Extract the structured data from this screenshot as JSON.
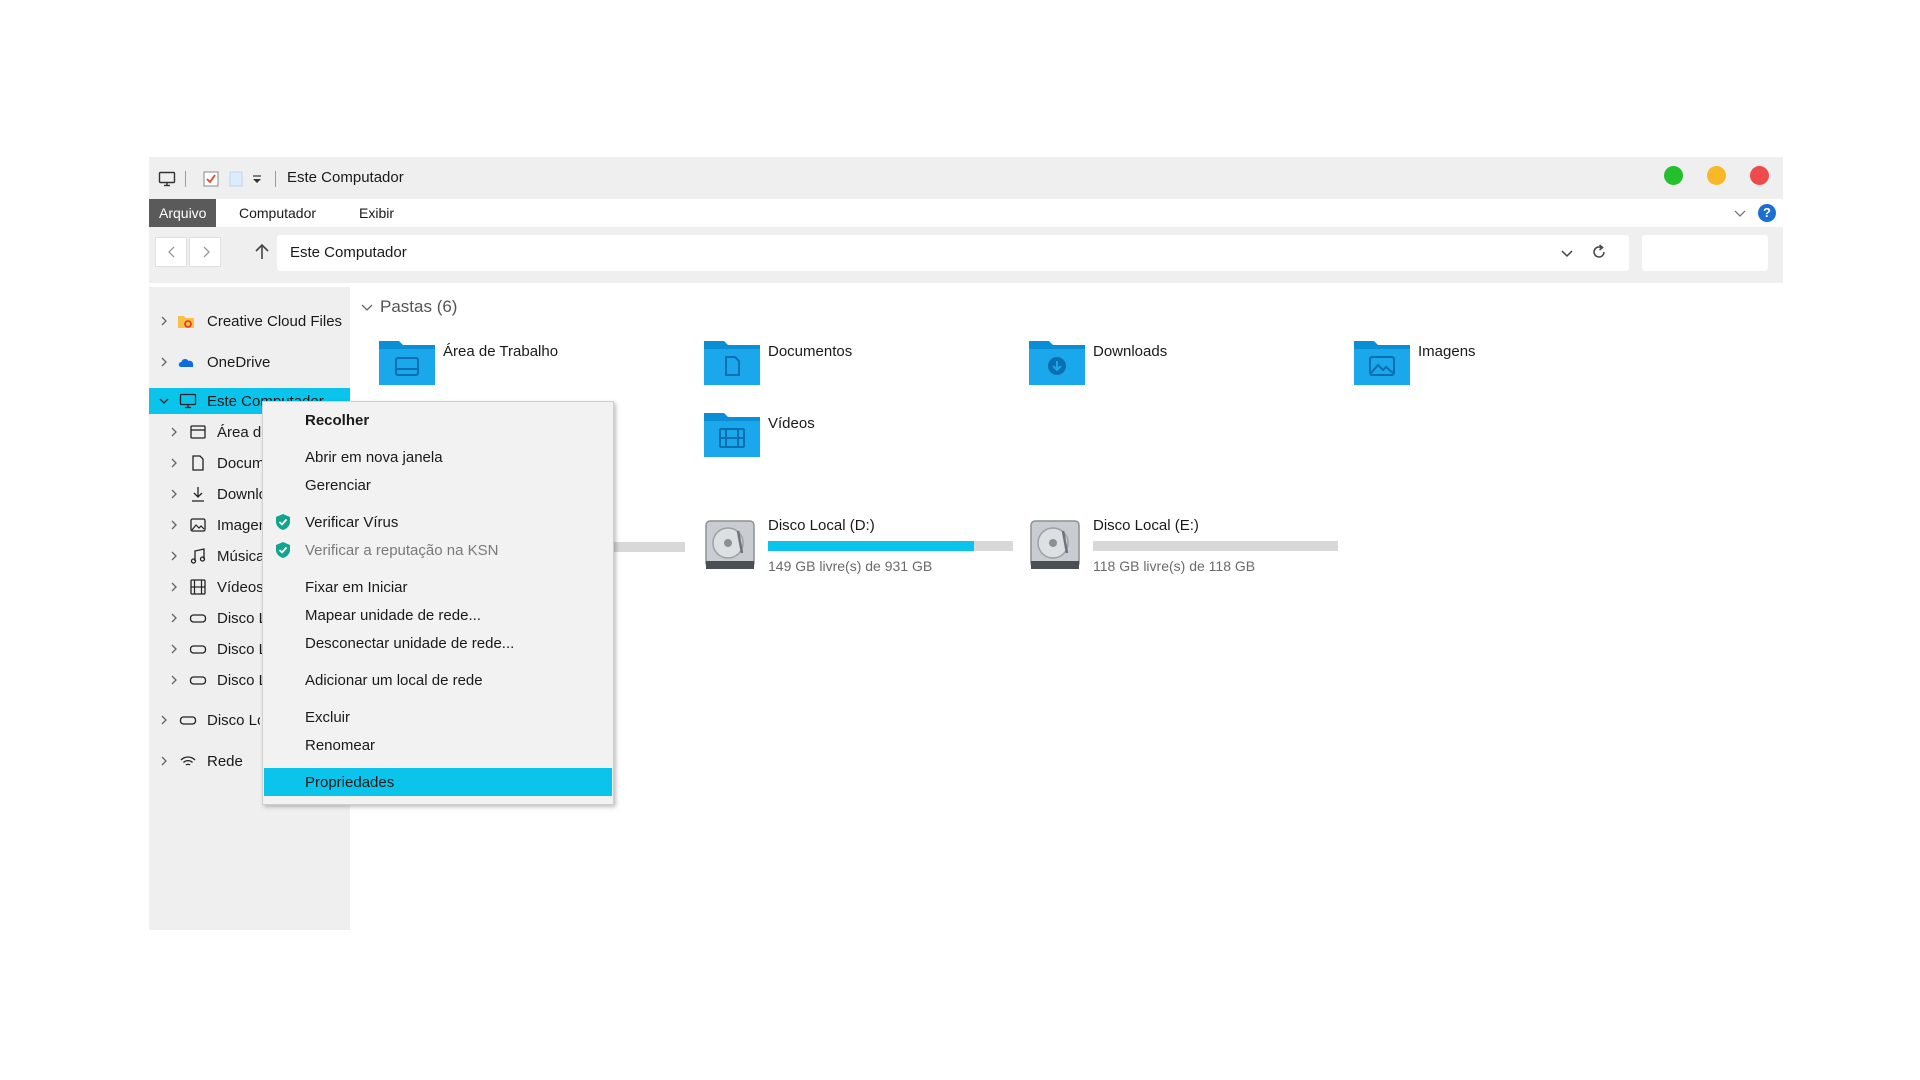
{
  "titlebar": {
    "title": "Este Computador",
    "colors": {
      "green": "#22c02a",
      "yellow": "#f9b825",
      "red": "#ef4b4b"
    }
  },
  "menubar": {
    "items": [
      "Arquivo",
      "Computador",
      "Exibir"
    ],
    "help_label": "?"
  },
  "address": {
    "path": "Este Computador"
  },
  "sidebar": {
    "items": [
      {
        "label": "Creative Cloud Files",
        "icon": "creative-cloud-folder-icon"
      },
      {
        "label": "OneDrive",
        "icon": "onedrive-cloud-icon"
      },
      {
        "label": "Este Computador",
        "icon": "computer-icon"
      },
      {
        "label": "Área de Trabalho",
        "icon": "desktop-icon"
      },
      {
        "label": "Documentos",
        "icon": "document-icon"
      },
      {
        "label": "Downloads",
        "icon": "download-icon"
      },
      {
        "label": "Imagens",
        "icon": "image-icon"
      },
      {
        "label": "Músicas",
        "icon": "music-icon"
      },
      {
        "label": "Vídeos",
        "icon": "video-icon"
      },
      {
        "label": "Disco Local (C:)",
        "icon": "drive-icon"
      },
      {
        "label": "Disco Local (D:)",
        "icon": "drive-icon"
      },
      {
        "label": "Disco Local (E:)",
        "icon": "drive-icon"
      },
      {
        "label": "Disco Local",
        "icon": "drive-icon"
      },
      {
        "label": "Rede",
        "icon": "network-icon"
      }
    ]
  },
  "content": {
    "group_title": "Pastas (6)",
    "folders": [
      {
        "label": "Área de Trabalho",
        "icon": "desktop-folder-icon"
      },
      {
        "label": "Documentos",
        "icon": "documents-folder-icon"
      },
      {
        "label": "Downloads",
        "icon": "downloads-folder-icon"
      },
      {
        "label": "Imagens",
        "icon": "images-folder-icon"
      },
      {
        "label": "Vídeos",
        "icon": "videos-folder-icon"
      }
    ],
    "drives": [
      {
        "name": "Disco Local (D:)",
        "free": "149 GB livre(s) de 931 GB",
        "used_fraction": 0.84
      },
      {
        "name": "Disco Local (E:)",
        "free": "118 GB livre(s) de 118 GB",
        "used_fraction": 0.0
      }
    ],
    "hidden_drive_used_fraction": 0.0
  },
  "context_menu": {
    "items": [
      {
        "label": "Recolher",
        "bold": true
      },
      {
        "label": "Abrir em nova janela"
      },
      {
        "label": "Gerenciar"
      },
      {
        "label": "Verificar Vírus",
        "icon": "shield-check-icon"
      },
      {
        "label": "Verificar a reputação na KSN",
        "icon": "shield-check-icon",
        "disabled": true
      },
      {
        "label": "Fixar em Iniciar"
      },
      {
        "label": "Mapear unidade de rede..."
      },
      {
        "label": "Desconectar unidade de rede..."
      },
      {
        "label": "Adicionar um local de rede"
      },
      {
        "label": "Excluir"
      },
      {
        "label": "Renomear"
      },
      {
        "label": "Propriedades",
        "highlight": true
      }
    ]
  }
}
